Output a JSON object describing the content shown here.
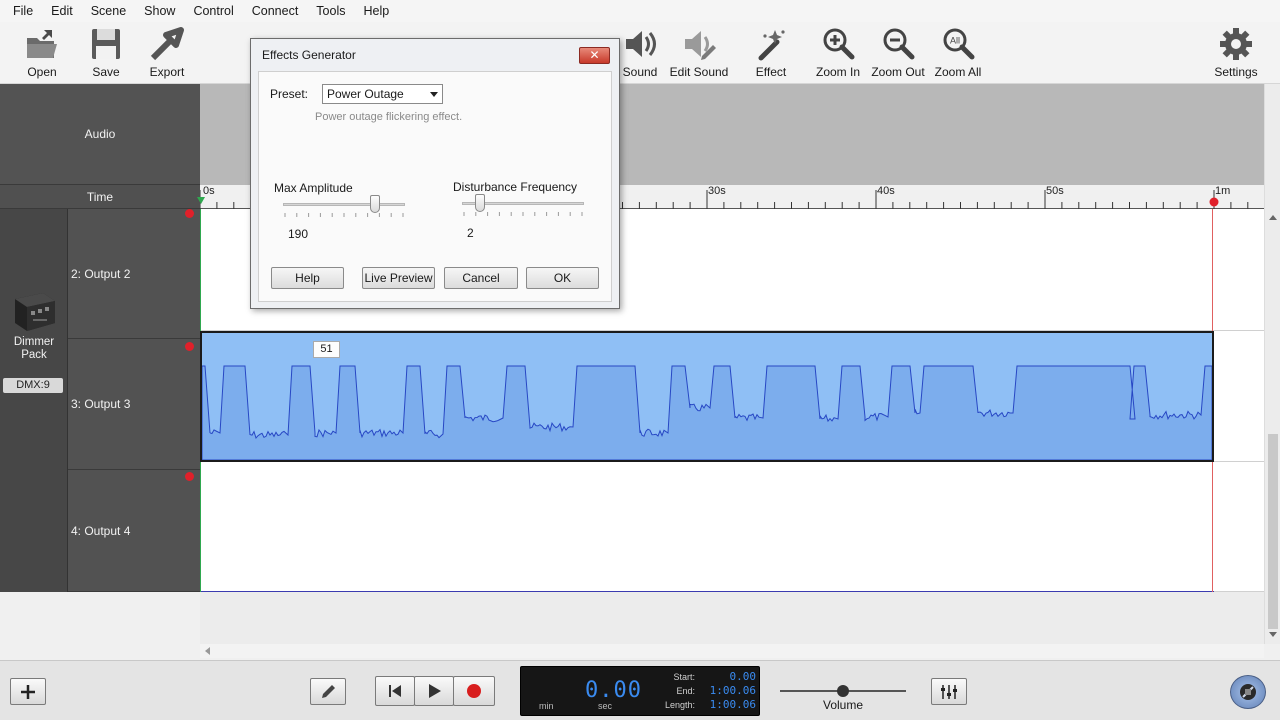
{
  "menu": [
    "File",
    "Edit",
    "Scene",
    "Show",
    "Control",
    "Connect",
    "Tools",
    "Help"
  ],
  "toolbar": {
    "open": "Open",
    "save": "Save",
    "export": "Export",
    "sound": "Sound",
    "edit_sound": "Edit Sound",
    "effect": "Effect",
    "zoom_in": "Zoom In",
    "zoom_out": "Zoom Out",
    "zoom_all": "Zoom All",
    "zoom_all_badge": "All",
    "settings": "Settings"
  },
  "track_header": {
    "audio": "Audio",
    "time": "Time",
    "device": {
      "name": "Dimmer Pack",
      "address": "DMX:9"
    },
    "outputs": [
      "2: Output 2",
      "3: Output 3",
      "4: Output 4"
    ]
  },
  "ruler": {
    "labels": [
      "0s",
      "30s",
      "40s",
      "50s",
      "1m"
    ]
  },
  "effect_block": {
    "value_badge": "51",
    "color": "#8fbff5"
  },
  "dialog": {
    "title": "Effects Generator",
    "close": "✕",
    "preset_label": "Preset:",
    "preset_value": "Power Outage",
    "preset_description": "Power outage flickering effect.",
    "max_amplitude": {
      "label": "Max Amplitude",
      "value": "190",
      "fraction": 0.75
    },
    "disturbance_frequency": {
      "label": "Disturbance Frequency",
      "value": "2",
      "fraction": 0.15
    },
    "buttons": {
      "help": "Help",
      "live_preview": "Live Preview",
      "cancel": "Cancel",
      "ok": "OK"
    }
  },
  "transport": {
    "time_display": "0.00",
    "min_label": "min",
    "sec_label": "sec",
    "start_label": "Start:",
    "start_value": "0.00",
    "end_label": "End:",
    "end_value": "1:00.06",
    "length_label": "Length:",
    "length_value": "1:00.06",
    "volume_label": "Volume",
    "volume_fraction": 0.5
  },
  "colors": {
    "accent": "#3a8bf0",
    "record": "#d81e1e",
    "marker": "#e0202a"
  }
}
